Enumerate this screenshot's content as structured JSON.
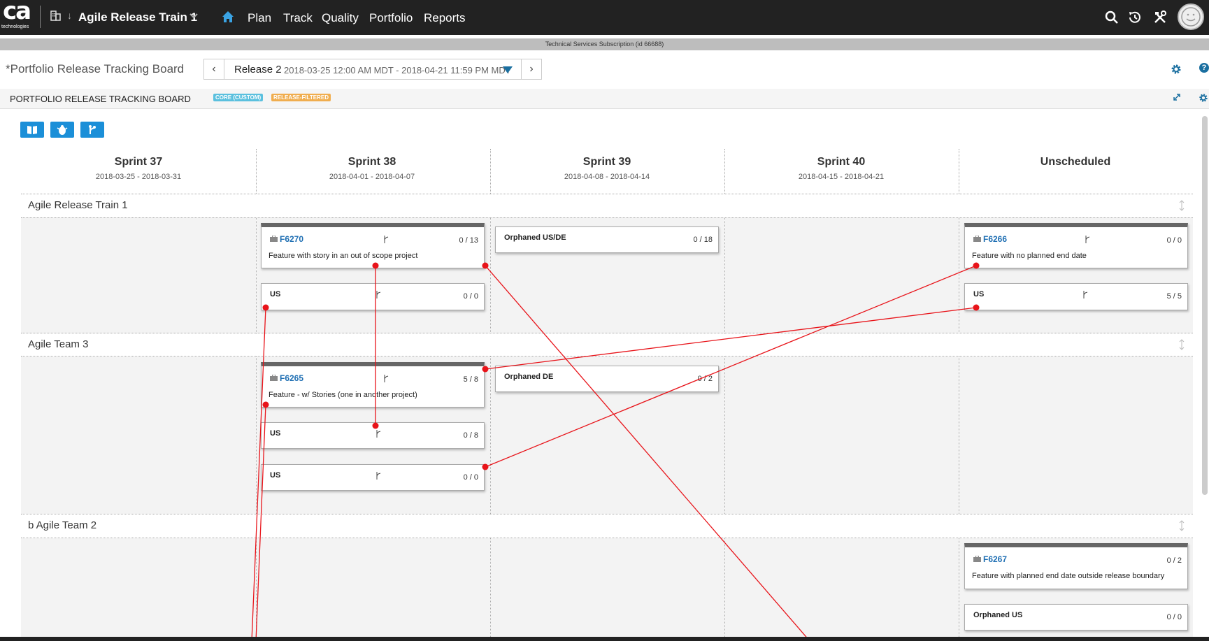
{
  "nav": {
    "logo_main": "ca",
    "logo_sub": "technologies",
    "workspace": "Agile Release Train 1",
    "items": [
      "Plan",
      "Track",
      "Quality",
      "Portfolio",
      "Reports"
    ]
  },
  "subscription": "Technical Services Subscription (id 66688)",
  "page": {
    "title": "*Portfolio Release Tracking Board",
    "release_name": "Release 2",
    "release_dates": "2018-03-25 12:00 AM MDT - 2018-04-21 11:59 PM MDT"
  },
  "app": {
    "title": "PORTFOLIO RELEASE TRACKING BOARD",
    "tags": [
      "CORE (CUSTOM)",
      "RELEASE-FILTERED"
    ]
  },
  "columns": [
    {
      "name": "Sprint 37",
      "dates": "2018-03-25 - 2018-03-31"
    },
    {
      "name": "Sprint 38",
      "dates": "2018-04-01 - 2018-04-07"
    },
    {
      "name": "Sprint 39",
      "dates": "2018-04-08 - 2018-04-14"
    },
    {
      "name": "Sprint 40",
      "dates": "2018-04-15 - 2018-04-21"
    },
    {
      "name": "Unscheduled",
      "dates": ""
    }
  ],
  "lanes": [
    {
      "name": "Agile Release Train 1"
    },
    {
      "name": "Agile Team 3"
    },
    {
      "name": "b Agile Team 2"
    }
  ],
  "cards": {
    "f6270": {
      "id": "F6270",
      "name": "Feature with story in an out of scope project",
      "count": "0 / 13"
    },
    "f6270_us": {
      "title": "US",
      "count": "0 / 0"
    },
    "orph_usde": {
      "title": "Orphaned US/DE",
      "count": "0 / 18"
    },
    "f6266": {
      "id": "F6266",
      "name": "Feature with no planned end date",
      "count": "0 / 0"
    },
    "f6266_us": {
      "title": "US",
      "count": "5 / 5"
    },
    "f6265": {
      "id": "F6265",
      "name": "Feature - w/ Stories (one in another project)",
      "count": "5 / 8"
    },
    "f6265_us1": {
      "title": "US",
      "count": "0 / 8"
    },
    "f6265_us2": {
      "title": "US",
      "count": "0 / 0"
    },
    "orph_de": {
      "title": "Orphaned DE",
      "count": "0 / 2"
    },
    "f6267": {
      "id": "F6267",
      "name": "Feature with planned end date outside release boundary",
      "count": "0 / 2"
    },
    "orph_us": {
      "title": "Orphaned US",
      "count": "0 / 0"
    }
  },
  "colors": {
    "nav_bg": "#222222",
    "accent": "#1b8fd8",
    "link": "#1f6fb3",
    "dependency_line": "#e8141a",
    "tag_core": "#5bc0de",
    "tag_release": "#f0ad4e"
  }
}
